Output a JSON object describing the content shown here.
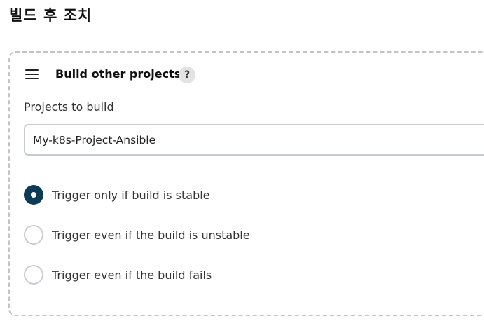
{
  "section": {
    "title": "빌드 후 조치"
  },
  "card": {
    "title": "Build other projects",
    "help_label": "?",
    "projects_label": "Projects to build",
    "projects_value": "My-k8s-Project-Ansible"
  },
  "trigger_options": [
    {
      "label": "Trigger only if build is stable",
      "selected": true
    },
    {
      "label": "Trigger even if the build is unstable",
      "selected": false
    },
    {
      "label": "Trigger even if the build fails",
      "selected": false
    }
  ],
  "icons": {
    "drag_handle": "hamburger-drag-icon",
    "help": "question-mark-icon"
  },
  "colors": {
    "radio_selected": "#0d3a55",
    "dashed_border": "#c4c4c4",
    "help_bg": "#e3e3e3"
  }
}
